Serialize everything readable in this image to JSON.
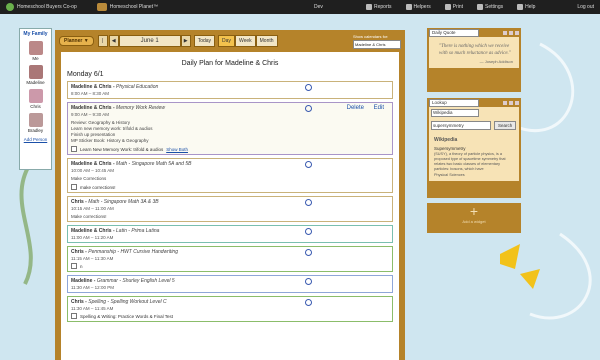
{
  "topbar": {
    "brand1": "Homeschool Buyers Co-op",
    "brand2": "Homeschool Planet™",
    "user": "Dev",
    "nav": [
      {
        "label": "Reports",
        "icon": "reports-icon"
      },
      {
        "label": "Helpers",
        "icon": "helpers-icon"
      },
      {
        "label": "Print",
        "icon": "print-icon"
      },
      {
        "label": "Settings",
        "icon": "settings-icon"
      },
      {
        "label": "Help",
        "icon": "help-icon"
      }
    ],
    "logout": "Log out"
  },
  "family": {
    "title": "My Family",
    "members": [
      "Me",
      "Madeline",
      "Chris",
      "Bradley"
    ],
    "add": "Add Person"
  },
  "toolbar": {
    "planner": "Planner ▼",
    "prev": "|",
    "prev_arrow": "◀",
    "date": "June 1",
    "next_arrow": "▶",
    "today": "Today",
    "views": [
      "Day",
      "Week",
      "Month"
    ],
    "cal_label": "Show calendars for:",
    "cal_value": "Madeline & Chris"
  },
  "plan": {
    "title": "Daily Plan for Madeline & Chris",
    "day": "Monday 6/1",
    "events": [
      {
        "who": "Madeline & Chris",
        "subject": "Physical Education",
        "time": "8:00 AM – 8:30 AM"
      },
      {
        "who": "Madeline & Chris",
        "subject": "Memory Work Review",
        "time": "9:00 AM – 9:30 AM",
        "notes": [
          "Review: Geography & History",
          "Learn new memory work: trifold & audios",
          "Finish up presentation",
          "MP Sticker Book: History & Geography"
        ],
        "check": "Learn New Memory Work: trifold & audios",
        "check_link": "Show Both",
        "delete": "Delete",
        "edit": "Edit"
      },
      {
        "who": "Madeline & Chris",
        "subject": "Math - Singapore Math 5A and 5B",
        "time": "10:00 AM – 10:45 AM",
        "notes": [
          "Make Corrections"
        ],
        "check": "make corrections!"
      },
      {
        "who": "Chris",
        "subject": "Math - Singapore Math 3A & 3B",
        "time": "10:15 AM – 11:00 AM",
        "blank": "Make corrections!"
      },
      {
        "who": "Madeline & Chris",
        "subject": "Latin - Prima Latina",
        "time": "11:00 AM – 11:20 AM"
      },
      {
        "who": "Chris",
        "subject": "Penmanship - HWT Cursive Handwriting",
        "time": "11:15 AM – 11:30 AM",
        "check": "n"
      },
      {
        "who": "Madeline",
        "subject": "Grammar - Shurley English Level 5",
        "time": "11:30 AM – 12:00 PM"
      },
      {
        "who": "Chris",
        "subject": "Spelling - Spelling Workout Level C",
        "time": "11:30 AM – 11:45 AM",
        "check": "Spelling & Writing: Practice Words & Final Test"
      }
    ]
  },
  "quote_widget": {
    "select": "Daily Quote",
    "text": "\"There is nothing which we receive with so much reluctance as advice.\"",
    "author": "— Joseph Addison"
  },
  "lookup_widget": {
    "select": "Lookup",
    "source": "Wikipedia",
    "query": "supersymmetry",
    "button": "Search",
    "result_title": "Wikipedia",
    "term": "Supersymmetry",
    "text": "(SUSY), a theory of particle physics, is a proposed type of spacetime symmetry that relates two basic classes of elementary particles: bosons, which have",
    "more": "Physical Sciences"
  },
  "add_widget": {
    "plus": "+",
    "label": "Add a widget"
  }
}
